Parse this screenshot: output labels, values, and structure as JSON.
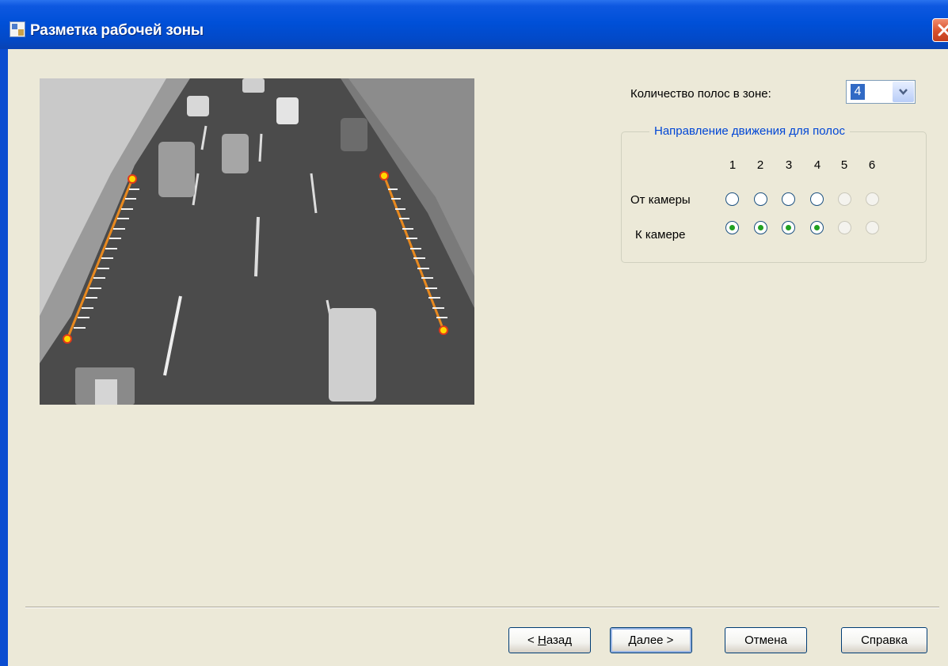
{
  "window": {
    "title": "Разметка рабочей зоны",
    "icon": "wizard-app-icon"
  },
  "lanes": {
    "count_label": "Количество полос в зоне:",
    "count_value": "4",
    "direction_group_title": "Направление движения для полос",
    "column_numbers": [
      "1",
      "2",
      "3",
      "4",
      "5",
      "6"
    ],
    "rows": [
      {
        "label": "От камеры",
        "states": [
          "unchecked",
          "unchecked",
          "unchecked",
          "unchecked",
          "disabled",
          "disabled"
        ]
      },
      {
        "label": "К камере",
        "states": [
          "checked",
          "checked",
          "checked",
          "checked",
          "disabled",
          "disabled"
        ]
      }
    ]
  },
  "colors": {
    "marker_line": "#e8891f",
    "marker_point": "#ffd700",
    "title_bar": "#0050d8",
    "group_title": "#0046d5"
  },
  "buttons": {
    "back": {
      "prefix": "< ",
      "hotkey": "Н",
      "rest": "азад"
    },
    "next": {
      "hotkey": "Д",
      "rest": "алее >"
    },
    "cancel": "Отмена",
    "help": "Справка"
  }
}
